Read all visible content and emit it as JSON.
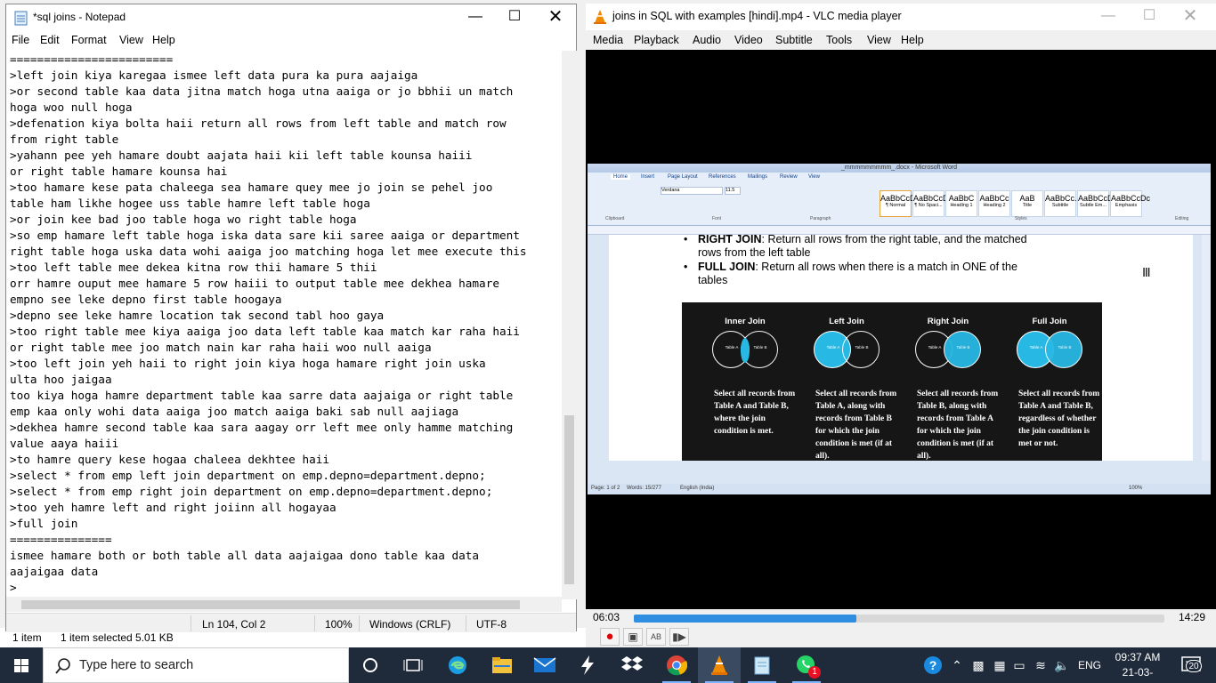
{
  "background": {
    "explorer_status": {
      "items": "1 item",
      "selected": "1 item selected  5.01 KB"
    }
  },
  "notepad": {
    "title": "*sql joins - Notepad",
    "menu": [
      "File",
      "Edit",
      "Format",
      "View",
      "Help"
    ],
    "lines": [
      "========================",
      ">left join kiya karegaa ismee left data pura ka pura aajaiga",
      ">or second table kaa data jitna match hoga utna aaiga or jo bbhii un match",
      "hoga woo null hoga",
      ">defenation kiya bolta haii return all rows from left table and match row",
      "from right table",
      ">yahann pee yeh hamare doubt aajata haii kii left table kounsa haiii",
      "or right table hamare kounsa hai",
      ">too hamare kese pata chaleega sea hamare quey mee jo join se pehel joo",
      "table ham likhe hogee uss table hamre left table hoga",
      ">or join kee bad joo table hoga wo right table hoga",
      ">so emp hamare left table hoga iska data sare kii saree aaiga or department",
      "right table hoga uska data wohi aaiga joo matching hoga let mee execute this",
      ">too left table mee dekea kitna row thii hamare 5 thii",
      "orr hamre ouput mee hamare 5 row haiii to output table mee dekhea hamare",
      "empno see leke depno first table hoogaya",
      ">depno see leke hamre location tak second tabl hoo gaya",
      ">too right table mee kiya aaiga joo data left table kaa match kar raha haii",
      "or right table mee joo match nain kar raha haii woo null aaiga",
      ">too left join yeh haii to right join kiya hoga hamare right join uska",
      "ulta hoo jaigaa",
      "too kiya hoga hamre department table kaa sarre data aajaiga or right table",
      "emp kaa only wohi data aaiga joo match aaiga baki sab null aajiaga",
      ">dekhea hamre second table kaa sara aagay orr left mee only hamme matching",
      "value aaya haiii",
      ">to hamre query kese hogaa chaleea dekhtee haii",
      ">select * from emp left join department on emp.depno=department.depno;",
      ">select * from emp right join department on emp.depno=department.depno;",
      ">too yeh hamre left and right joiinn all hogayaa",
      ">full join",
      "===============",
      "ismee hamare both or both table all data aajaigaa dono table kaa data",
      "aajaigaa data",
      ">"
    ],
    "status": {
      "position": "Ln 104, Col 2",
      "zoom": "100%",
      "line_ending": "Windows (CRLF)",
      "encoding": "UTF-8"
    }
  },
  "vlc": {
    "title": "joins in SQL with examples [hindi].mp4 - VLC media player",
    "menu": [
      "Media",
      "Playback",
      "Audio",
      "Video",
      "Subtitle",
      "Tools",
      "View",
      "Help"
    ],
    "time_elapsed": "06:03",
    "time_total": "14:29",
    "progress": 0.42,
    "word": {
      "title": "_mmmmmmmmm_.docx - Microsoft Word",
      "tabs": [
        "Home",
        "Insert",
        "Page Layout",
        "References",
        "Mailings",
        "Review",
        "View"
      ],
      "styles": [
        {
          "sample": "AaBbCcDc",
          "name": "¶ Normal"
        },
        {
          "sample": "AaBbCcDc",
          "name": "¶ No Spaci..."
        },
        {
          "sample": "AaBbC",
          "name": "Heading 1"
        },
        {
          "sample": "AaBbCc",
          "name": "Heading 2"
        },
        {
          "sample": "AaB",
          "name": "Title"
        },
        {
          "sample": "AaBbCc.",
          "name": "Subtitle"
        },
        {
          "sample": "AaBbCcDc",
          "name": "Subtle Em..."
        },
        {
          "sample": "AaBbCcDc",
          "name": "Emphasis"
        }
      ],
      "font": "Verdana",
      "font_size": "11.5",
      "groups": [
        "Clipboard",
        "Font",
        "Paragraph",
        "Styles",
        "Editing"
      ],
      "bullets": [
        {
          "term": "RIGHT JOIN",
          "text": ": Return all rows from the right table, and the matched",
          "text2": "rows from the left table"
        },
        {
          "term": "FULL JOIN",
          "text": ": Return all rows when there is a match in ONE of the",
          "text2": "tables"
        }
      ],
      "venns": [
        {
          "title": "Inner Join",
          "a": "Table A",
          "b": "Table B",
          "desc": "Select all records from Table A and Table B, where the join condition is met."
        },
        {
          "title": "Left Join",
          "a": "Table A",
          "b": "Table B",
          "desc": "Select all records from Table A, along with records from Table B for which the join condition is met (if at all)."
        },
        {
          "title": "Right Join",
          "a": "Table A",
          "b": "Table B",
          "desc": "Select all records from Table B, along with records from Table A for which the join condition is met (if at all)."
        },
        {
          "title": "Full Join",
          "a": "Table A",
          "b": "Table B",
          "desc": "Select all records from Table A and Table B, regardless of whether the join condition is met or not."
        }
      ],
      "status": {
        "page": "Page: 1 of 2",
        "words": "Words: 15/277",
        "lang": "English (India)",
        "zoom": "100%"
      }
    }
  },
  "taskbar": {
    "search_placeholder": "Type here to search",
    "language": "ENG",
    "time": "09:37 AM",
    "date": "21-03-2021",
    "notifications": "20",
    "whatsapp_badge": "1"
  },
  "colors": {
    "vlc_progress": "#2f8ee0",
    "venn_fill": "#27b9e4",
    "taskbar": "#1f2b3b"
  }
}
